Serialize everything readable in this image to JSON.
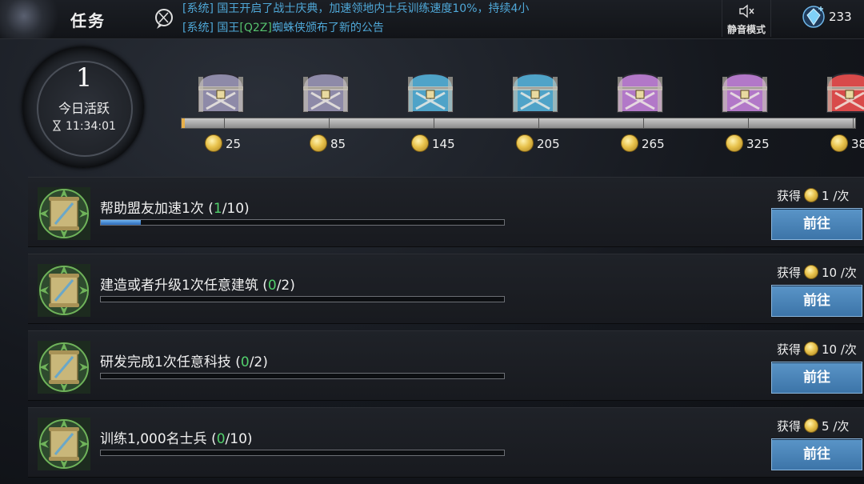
{
  "header": {
    "title": "任务",
    "messages": [
      {
        "prefix": "[系统]",
        "text": " 国王开启了战士庆典，加速领地内士兵训练速度10%，持续4小"
      },
      {
        "prefix": "[系统]",
        "text_before": " 国王",
        "highlight": "[Q2Z]",
        "text_after": "蜘蛛侠颁布了新的公告"
      }
    ],
    "mute_label": "静音模式",
    "gem_count": "233"
  },
  "activity": {
    "value": "1",
    "label": "今日活跃",
    "timer": "11:34:01",
    "progress_fraction": 0.005,
    "milestones": [
      "25",
      "85",
      "145",
      "205",
      "265",
      "325",
      "38"
    ],
    "chest_colors": [
      "#8e8aa8",
      "#8e8aa8",
      "#4fa3c8",
      "#4fa3c8",
      "#b278c8",
      "#b278c8",
      "#d84a4a"
    ]
  },
  "tasks": [
    {
      "name": "帮助盟友加速1次 (",
      "current": "1",
      "total": "/10)",
      "progress": 0.1,
      "reward_label": "获得",
      "reward_value": "1 /次",
      "button": "前往"
    },
    {
      "name": "建造或者升级1次任意建筑 (",
      "current": "0",
      "total": "/2)",
      "progress": 0,
      "reward_label": "获得",
      "reward_value": "10 /次",
      "button": "前往"
    },
    {
      "name": "研发完成1次任意科技 (",
      "current": "0",
      "total": "/2)",
      "progress": 0,
      "reward_label": "获得",
      "reward_value": "10 /次",
      "button": "前往"
    },
    {
      "name": "训练1,000名士兵 (",
      "current": "0",
      "total": "/10)",
      "progress": 0,
      "reward_label": "获得",
      "reward_value": "5 /次",
      "button": "前往"
    }
  ]
}
